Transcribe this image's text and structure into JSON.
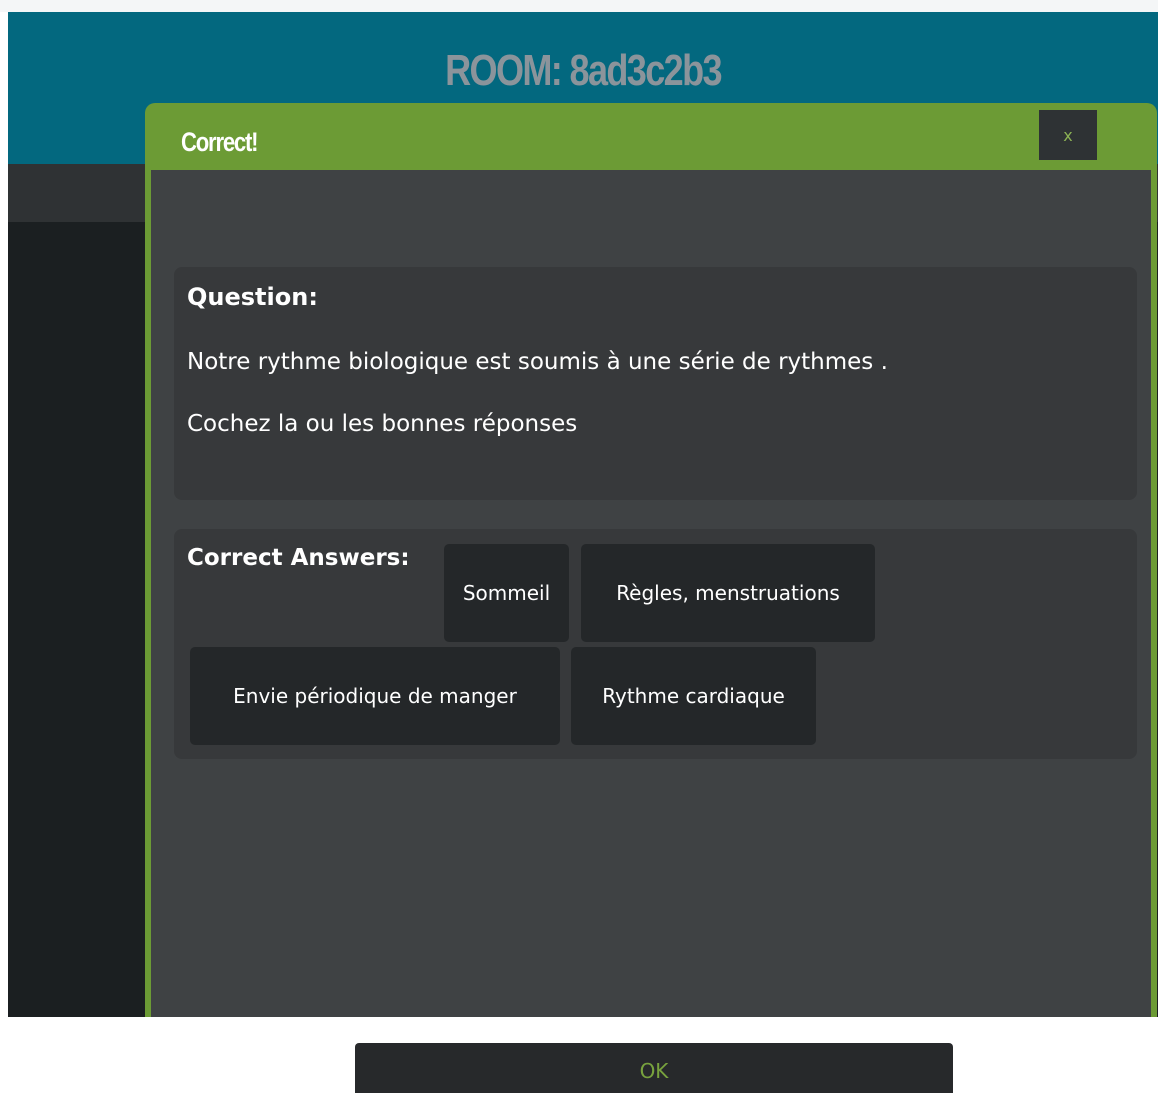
{
  "header": {
    "room_title": "ROOM: 8ad3c2b3"
  },
  "modal": {
    "title": "Correct!",
    "close_label": "x",
    "question": {
      "heading": "Question:",
      "lines": [
        "Notre rythme biologique est soumis à une série de rythmes .",
        "Cochez la ou les bonnes réponses"
      ]
    },
    "answers": {
      "heading": "Correct Answers:",
      "items": [
        "Sommeil",
        "Règles, menstruations",
        "Envie périodique de manger",
        "Rythme cardiaque"
      ]
    },
    "ok_label": "OK"
  },
  "colors": {
    "header_teal": "#03687f",
    "modal_green": "#6c9b35",
    "modal_body": "#3f4244",
    "panel": "#37393b",
    "chip": "#242729",
    "ok_text": "#78a23e"
  }
}
